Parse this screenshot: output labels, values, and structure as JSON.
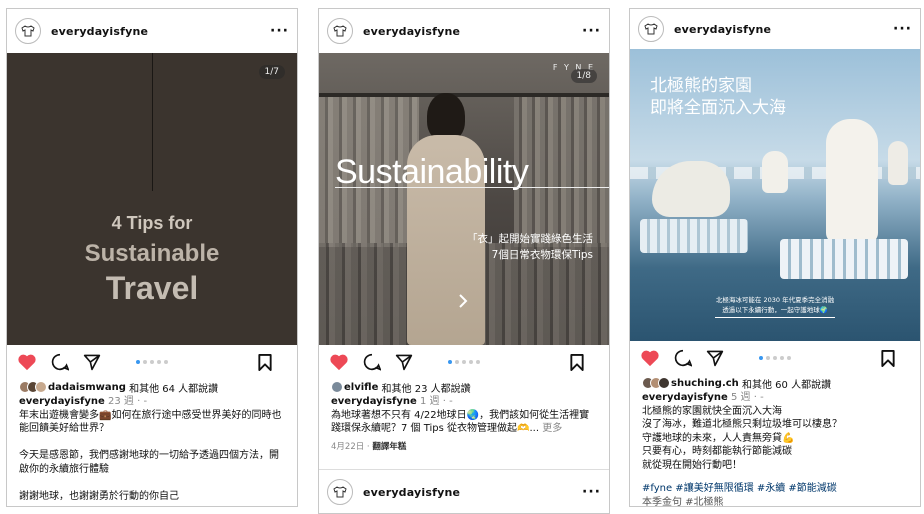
{
  "card1": {
    "username": "everydayisfyne",
    "counter": "1/7",
    "image": {
      "line1": "4 Tips for",
      "line2": "Sustainable",
      "line3": "Travel"
    },
    "likes_user": "dadaismwang",
    "likes_rest": "和其他 64 人都說讚",
    "caption_user": "everydayisfyne",
    "caption_time": "23 週 · -",
    "caption_text": "年末出遊機會變多💼如何在旅行途中感受世界美好的同時也能回饋美好給世界？\n\n今天是感恩節，我們感謝地球的一切給予透過四個方法，開啟你的永續旅行體驗\n\n謝謝地球，也謝謝勇於行動的你自己",
    "dots": [
      true,
      false,
      false,
      false,
      false
    ]
  },
  "card2": {
    "username": "everydayisfyne",
    "counter": "1/8",
    "brand": "F Y N E",
    "image": {
      "title": "Sustainability",
      "sub1": "「衣」起開始實踐綠色生活",
      "sub2": "7個日常衣物環保Tips"
    },
    "likes_user": "elvifle",
    "likes_rest": "和其他 23 人都說讚",
    "caption_user": "everydayisfyne",
    "caption_time": "1 週 · -",
    "caption_text": "為地球著想不只有 4/22地球日🌏，我們該如何從生活裡實踐環保永續呢？7 個 Tips 從衣物管理做起🫶... ",
    "more": "更多",
    "date": "4月22日",
    "translate": "翻譯年糕",
    "next_username": "everydayisfyne",
    "dots": [
      true,
      false,
      false,
      false,
      false
    ]
  },
  "card3": {
    "username": "everydayisfyne",
    "image": {
      "title1": "北極熊的家園",
      "title2": "即將全面沉入大海",
      "small1": "北極海冰可能在 2030 年代夏季完全消融",
      "small2": "透過以下永續行動，一起守護地球🌍"
    },
    "likes_user": "shuching.ch",
    "likes_rest": "和其他 60 人都說讚",
    "caption_user": "everydayisfyne",
    "caption_time": "5 週 · -",
    "caption_text": "北極熊的家園就快全面沉入大海\n沒了海冰，難道北極熊只剩垃圾堆可以棲息？\n守護地球的未來，人人責無旁貸💪\n只要有心，時刻都能執行節能減碳\n就從現在開始行動吧！",
    "tags": "#fyne #讓美好無限循環 #永續 #節能減碳",
    "cut_text": "本季金句 #北極熊",
    "dots": [
      true,
      false,
      false,
      false,
      false
    ]
  },
  "colors": {
    "heart": "#ed4956",
    "dot_active": "#3897f0",
    "link": "#00376b"
  }
}
